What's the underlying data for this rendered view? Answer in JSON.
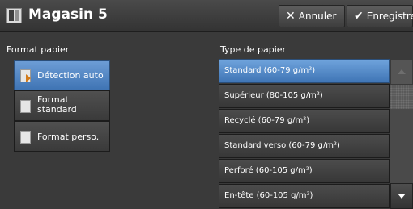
{
  "header": {
    "title": "Magasin 5",
    "icon": "paper-tray-icon",
    "cancel_label": "Annuler",
    "cancel_icon": "close-icon",
    "save_label": "Enregistrer",
    "save_icon": "checkmark-icon"
  },
  "format": {
    "label": "Format papier",
    "options": [
      {
        "label": "Détection auto",
        "selected": true
      },
      {
        "label": "Format standard",
        "selected": false
      },
      {
        "label": "Format perso.",
        "selected": false
      }
    ]
  },
  "type": {
    "label": "Type de papier",
    "items": [
      {
        "label": "Standard (60-79 g/m²)",
        "selected": true
      },
      {
        "label": "Supérieur (80-105 g/m²)",
        "selected": false
      },
      {
        "label": "Recyclé (60-79 g/m²)",
        "selected": false
      },
      {
        "label": "Standard verso (60-79 g/m²)",
        "selected": false
      },
      {
        "label": "Perforé (60-105 g/m²)",
        "selected": false
      },
      {
        "label": "En-tête (60-105 g/m²)",
        "selected": false
      }
    ]
  },
  "colors": {
    "accent": "#4f86c6",
    "background": "#3a3a3a"
  }
}
